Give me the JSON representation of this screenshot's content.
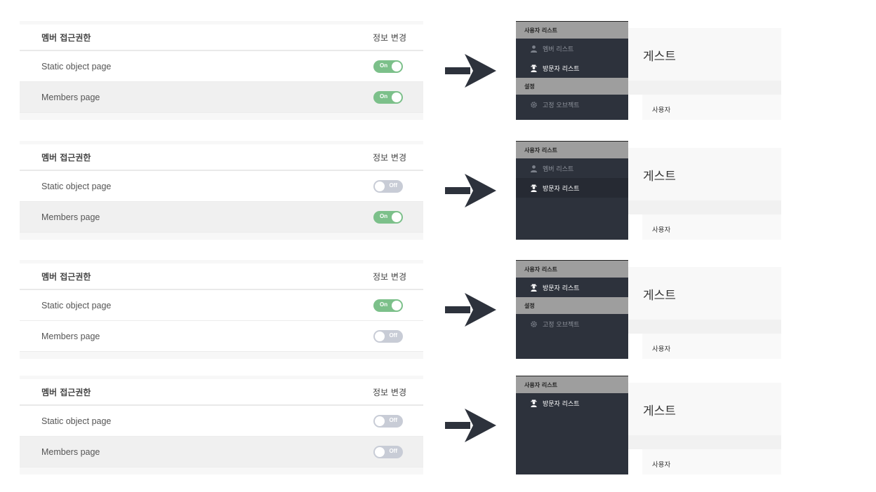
{
  "colors": {
    "toggle_on": "#7cc08a",
    "toggle_off": "#c8ccd6",
    "sidebar_bg": "#2d323c",
    "section_header_bg": "#9e9e9e",
    "arrow": "#2d323c"
  },
  "table_headers": {
    "left": "멤버 접근권한",
    "right": "정보 변경"
  },
  "preview_texts": {
    "title": "게스트",
    "subtitle": "사용자"
  },
  "scenarios": [
    {
      "settings": [
        {
          "label": "Static object page",
          "state": "On"
        },
        {
          "label": "Members page",
          "state": "On"
        }
      ],
      "sidebar": [
        {
          "section": "사용자 리스트"
        },
        {
          "item": "멤버 리스트",
          "icon": "user-icon",
          "style": "dim"
        },
        {
          "item": "방문자 리스트",
          "icon": "guest-icon",
          "style": "normal"
        },
        {
          "section": "설정"
        },
        {
          "item": "고정 오브젝트",
          "icon": "gear-icon",
          "style": "dim"
        }
      ]
    },
    {
      "settings": [
        {
          "label": "Static object page",
          "state": "Off"
        },
        {
          "label": "Members page",
          "state": "On"
        }
      ],
      "sidebar": [
        {
          "section": "사용자 리스트"
        },
        {
          "item": "멤버 리스트",
          "icon": "user-icon",
          "style": "dim"
        },
        {
          "item": "방문자 리스트",
          "icon": "guest-icon",
          "style": "active"
        }
      ]
    },
    {
      "settings": [
        {
          "label": "Static object page",
          "state": "On"
        },
        {
          "label": "Members page",
          "state": "Off"
        }
      ],
      "sidebar": [
        {
          "section": "사용자 리스트"
        },
        {
          "item": "방문자 리스트",
          "icon": "guest-icon",
          "style": "normal"
        },
        {
          "section": "설정"
        },
        {
          "item": "고정 오브젝트",
          "icon": "gear-icon",
          "style": "dim"
        }
      ]
    },
    {
      "settings": [
        {
          "label": "Static object page",
          "state": "Off"
        },
        {
          "label": "Members page",
          "state": "Off"
        }
      ],
      "sidebar": [
        {
          "section": "사용자 리스트"
        },
        {
          "item": "방문자 리스트",
          "icon": "guest-icon",
          "style": "normal"
        }
      ]
    }
  ]
}
